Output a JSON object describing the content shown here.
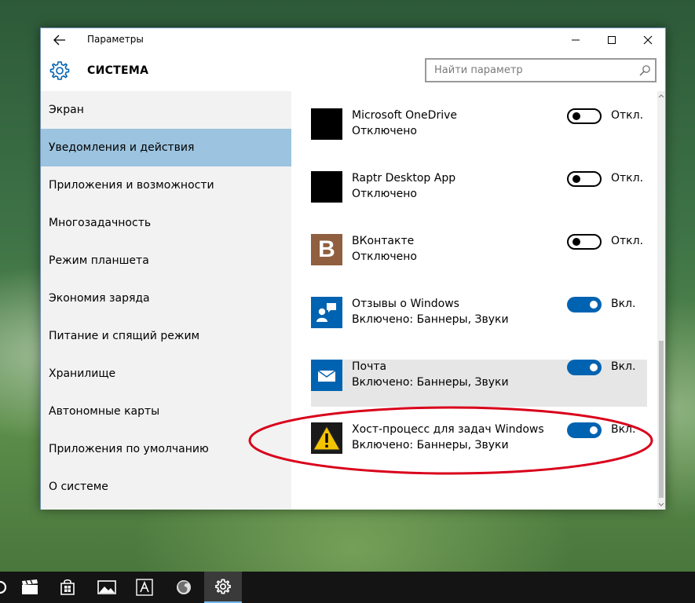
{
  "window": {
    "title": "Параметры",
    "section_title": "СИСТЕМА"
  },
  "search": {
    "placeholder": "Найти параметр"
  },
  "sidebar": {
    "items": [
      {
        "label": "Экран"
      },
      {
        "label": "Уведомления и действия",
        "active": true
      },
      {
        "label": "Приложения и возможности"
      },
      {
        "label": "Многозадачность"
      },
      {
        "label": "Режим планшета"
      },
      {
        "label": "Экономия заряда"
      },
      {
        "label": "Питание и спящий режим"
      },
      {
        "label": "Хранилище"
      },
      {
        "label": "Автономные карты"
      },
      {
        "label": "Приложения по умолчанию"
      },
      {
        "label": "О системе"
      }
    ]
  },
  "apps": [
    {
      "name": "Microsoft OneDrive",
      "status": "Отключено",
      "toggle": "Откл.",
      "on": false,
      "icon": "black-square-icon"
    },
    {
      "name": "Raptr Desktop App",
      "status": "Отключено",
      "toggle": "Откл.",
      "on": false,
      "icon": "black-square-icon"
    },
    {
      "name": "ВКонтакте",
      "status": "Отключено",
      "toggle": "Откл.",
      "on": false,
      "icon": "vk-letter-b-icon",
      "icon_glyph": "B"
    },
    {
      "name": "Отзывы о Windows",
      "status": "Включено: Баннеры, Звуки",
      "toggle": "Вкл.",
      "on": true,
      "icon": "feedback-icon"
    },
    {
      "name": "Почта",
      "status": "Включено: Баннеры, Звуки",
      "toggle": "Вкл.",
      "on": true,
      "icon": "mail-icon"
    },
    {
      "name": "Хост-процесс для задач Windows",
      "status": "Включено: Баннеры, Звуки",
      "toggle": "Вкл.",
      "on": true,
      "icon": "warning-icon"
    }
  ],
  "colors": {
    "accent": "#0063b1",
    "sidebar_active": "#9cc3df",
    "annotation": "#d9001b",
    "vk_brown": "#8f5f3f"
  },
  "taskbar": {
    "items": [
      "movies-icon",
      "store-icon",
      "photos-icon",
      "fonts-icon",
      "firefox-icon",
      "settings-icon"
    ]
  }
}
